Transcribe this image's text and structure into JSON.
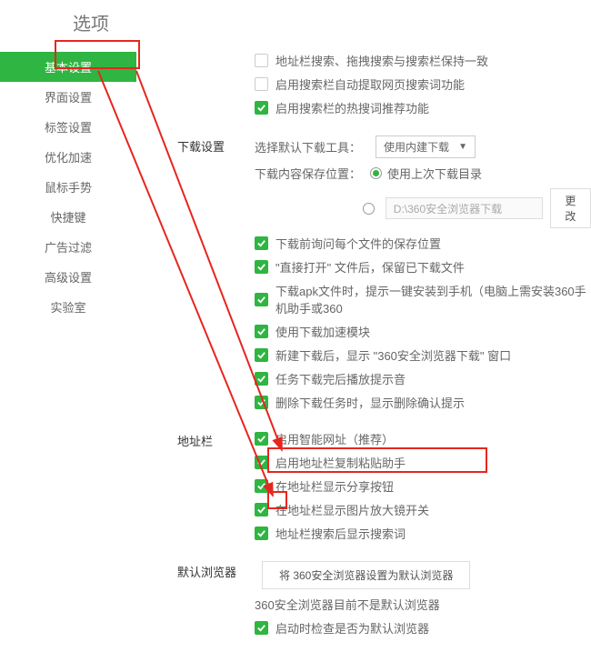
{
  "header": {
    "title": "选项"
  },
  "sidebar": {
    "items": [
      {
        "label": "基本设置",
        "active": true
      },
      {
        "label": "界面设置"
      },
      {
        "label": "标签设置"
      },
      {
        "label": "优化加速"
      },
      {
        "label": "鼠标手势"
      },
      {
        "label": "快捷键"
      },
      {
        "label": "广告过滤"
      },
      {
        "label": "高级设置"
      },
      {
        "label": "实验室"
      }
    ]
  },
  "search_section": {
    "rows": [
      {
        "checked": false,
        "text": "地址栏搜索、拖拽搜索与搜索栏保持一致"
      },
      {
        "checked": false,
        "text": "启用搜索栏自动提取网页搜索词功能"
      },
      {
        "checked": true,
        "text": "启用搜索栏的热搜词推荐功能"
      }
    ]
  },
  "download_section": {
    "label": "下载设置",
    "tool_label": "选择默认下载工具：",
    "tool_select": "使用内建下载",
    "save_label": "下载内容保存位置：",
    "radio_last": "使用上次下载目录",
    "path_value": "D:\\360安全浏览器下载",
    "change_btn": "更改",
    "rows": [
      {
        "checked": true,
        "text": "下载前询问每个文件的保存位置"
      },
      {
        "checked": true,
        "text": "\"直接打开\" 文件后，保留已下载文件"
      },
      {
        "checked": true,
        "text": "下载apk文件时，提示一键安装到手机（电脑上需安装360手机助手或360"
      },
      {
        "checked": true,
        "text": "使用下载加速模块"
      },
      {
        "checked": true,
        "text": "新建下载后，显示 \"360安全浏览器下载\" 窗口"
      },
      {
        "checked": true,
        "text": "任务下载完后播放提示音"
      },
      {
        "checked": true,
        "text": "删除下载任务时，显示删除确认提示"
      }
    ]
  },
  "address_section": {
    "label": "地址栏",
    "rows": [
      {
        "checked": true,
        "text": "启用智能网址（推荐）"
      },
      {
        "checked": true,
        "text": "启用地址栏复制粘贴助手"
      },
      {
        "checked": true,
        "text": "在地址栏显示分享按钮"
      },
      {
        "checked": true,
        "text": "在地址栏显示图片放大镜开关"
      },
      {
        "checked": true,
        "text": "地址栏搜索后显示搜索词"
      }
    ]
  },
  "default_section": {
    "label": "默认浏览器",
    "button": "将 360安全浏览器设置为默认浏览器",
    "status": "360安全浏览器目前不是默认浏览器",
    "check_row": {
      "checked": true,
      "text": "启动时检查是否为默认浏览器"
    }
  }
}
